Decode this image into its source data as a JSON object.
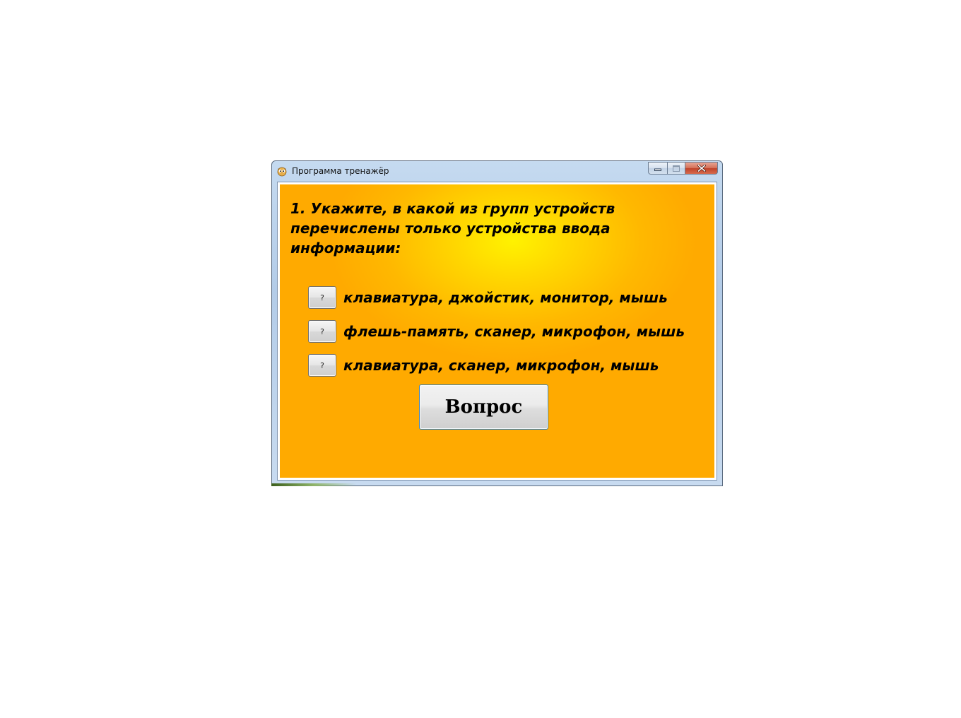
{
  "window": {
    "title": "Программа тренажёр"
  },
  "question": {
    "text": "1. Укажите, в какой из групп устройств перечислены только устройства ввода информации:"
  },
  "answers": [
    {
      "button_label": "?",
      "text": "клавиатура, джойстик, монитор, мышь"
    },
    {
      "button_label": "?",
      "text": "флешь-память, сканер, микрофон, мышь"
    },
    {
      "button_label": "?",
      "text": "клавиатура, сканер, микрофон, мышь"
    }
  ],
  "main_button": {
    "label": "Вопрос"
  },
  "colors": {
    "panel_background": "#ffaa00",
    "panel_highlight": "#fff200",
    "close_button": "#c0432a"
  },
  "icons": {
    "app": "owl-icon",
    "minimize": "minimize-icon",
    "maximize": "maximize-icon",
    "close": "close-icon"
  }
}
